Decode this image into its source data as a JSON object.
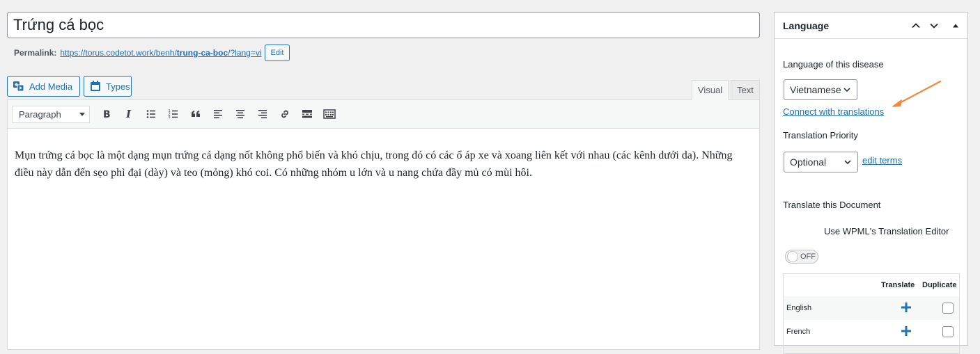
{
  "post": {
    "title": "Trứng cá bọc",
    "permalink_label": "Permalink:",
    "permalink_prefix": "https://torus.codetot.work/benh/",
    "permalink_slug": "trung-ca-boc",
    "permalink_suffix": "/?lang=vi",
    "edit_label": "Edit"
  },
  "media": {
    "add_media_label": "Add Media",
    "types_label": "Types"
  },
  "editor": {
    "tabs": [
      {
        "label": "Visual",
        "active": true
      },
      {
        "label": "Text",
        "active": false
      }
    ],
    "format_value": "Paragraph",
    "toolbar_icons": [
      "bold-icon",
      "italic-icon",
      "bulleted-list-icon",
      "numbered-list-icon",
      "blockquote-icon",
      "align-left-icon",
      "align-center-icon",
      "align-right-icon",
      "insert-link-icon",
      "read-more-icon",
      "toolbar-toggle-icon"
    ],
    "content": "Mụn trứng cá bọc là một dạng mụn trứng cá dạng nốt không phổ biến và khó chịu, trong đó có các ổ áp xe và xoang liên kết với nhau (các kênh dưới da). Những điều này dẫn đến sẹo phì đại (dày) và teo (mỏng) khó coi. Có những nhóm u lớn và u nang chứa đầy mủ có mùi hôi."
  },
  "language_box": {
    "heading": "Language",
    "language_label": "Language of this disease",
    "language_value": "Vietnamese",
    "connect_link": "Connect with translations",
    "priority_label": "Translation Priority",
    "priority_value": "Optional",
    "edit_terms_link": "edit terms",
    "translate_doc_label": "Translate this Document",
    "toggle_state": "OFF",
    "toggle_label": "Use WPML's Translation Editor",
    "table_headers": {
      "translate": "Translate",
      "duplicate": "Duplicate"
    },
    "rows": [
      {
        "language": "English"
      },
      {
        "language": "French"
      }
    ]
  },
  "colors": {
    "accent": "#2271b1",
    "annotation_arrow": "#f0883e"
  }
}
